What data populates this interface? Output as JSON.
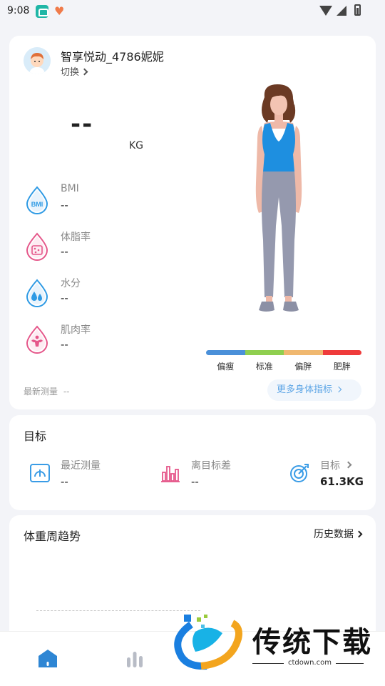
{
  "status_bar": {
    "time": "9:08"
  },
  "profile": {
    "username": "智享悦动_4786妮妮",
    "switch_label": "切换",
    "weight_value": "--",
    "weight_unit": "KG",
    "metrics": [
      {
        "label": "BMI",
        "value": "--",
        "icon": "bmi-drop-icon"
      },
      {
        "label": "体脂率",
        "value": "--",
        "icon": "body-fat-icon"
      },
      {
        "label": "水分",
        "value": "--",
        "icon": "water-icon"
      },
      {
        "label": "肌肉率",
        "value": "--",
        "icon": "muscle-icon"
      }
    ],
    "bmi_scale": [
      {
        "label": "偏瘦",
        "color": "#4a90d9"
      },
      {
        "label": "标准",
        "color": "#8fcf4f"
      },
      {
        "label": "偏胖",
        "color": "#f0b870"
      },
      {
        "label": "肥胖",
        "color": "#ef3b3b"
      }
    ],
    "latest_label": "最新测量",
    "latest_value": "--",
    "more_button": "更多身体指标"
  },
  "goal": {
    "title": "目标",
    "items": [
      {
        "label": "最近测量",
        "value": "--"
      },
      {
        "label": "离目标差",
        "value": "--"
      },
      {
        "label": "目标",
        "value": "61.3KG"
      }
    ]
  },
  "trend": {
    "title": "体重周趋势",
    "history_link": "历史数据"
  },
  "watermark": {
    "brand": "传统下载",
    "url": "ctdown.com"
  },
  "colors": {
    "accent_blue": "#3a9ce6",
    "pink": "#e5578a",
    "bmi_blue": "#2e9ae4"
  }
}
